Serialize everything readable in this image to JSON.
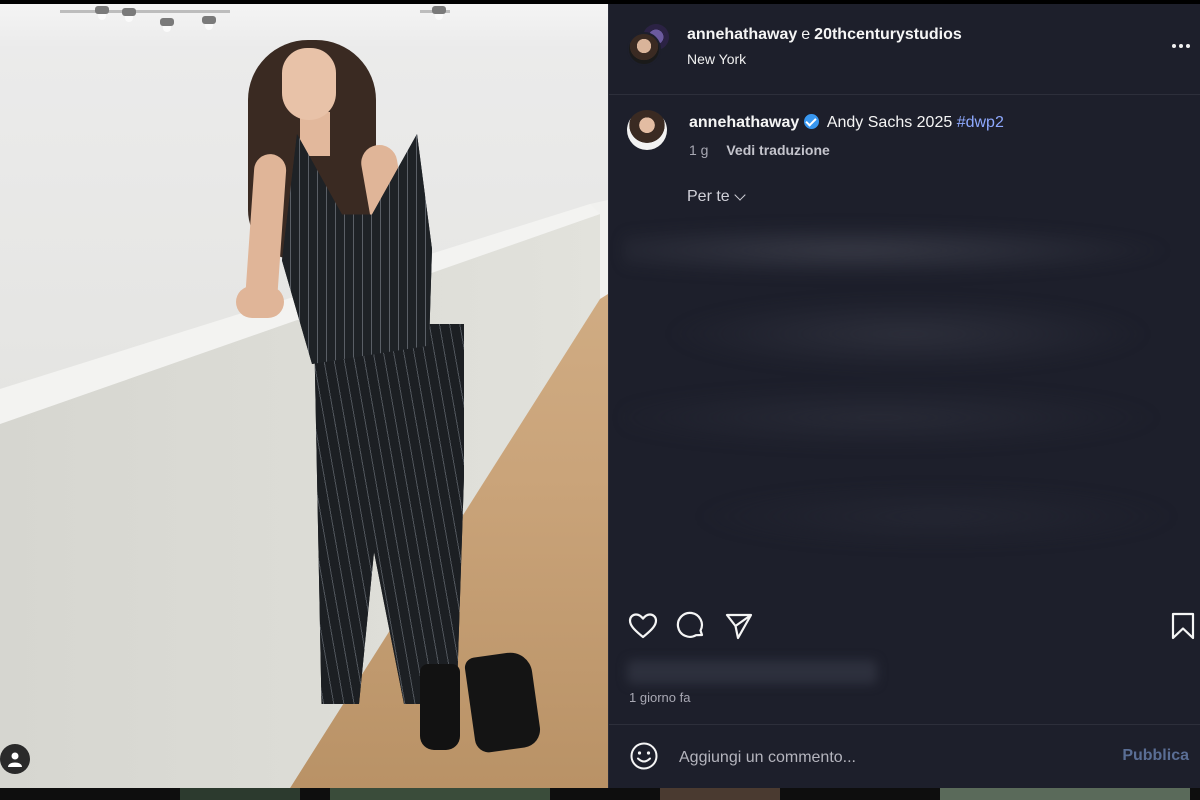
{
  "post": {
    "author": "annehathaway",
    "conjunction": "e",
    "coauthor": "20thcenturystudios",
    "location": "New York"
  },
  "caption": {
    "username": "annehathaway",
    "text": "Andy Sachs 2025",
    "hashtag": "#dwp2",
    "time": "1 g",
    "translate": "Vedi traduzione"
  },
  "comments": {
    "sort_label": "Per te"
  },
  "actions": {
    "like_icon": "heart-icon",
    "comment_icon": "comment-icon",
    "share_icon": "send-icon",
    "save_icon": "bookmark-icon"
  },
  "meta": {
    "time_ago": "1 giorno fa"
  },
  "comment_box": {
    "placeholder": "Aggiungi un commento...",
    "publish_label": "Pubblica"
  },
  "colors": {
    "panel_bg": "#1d1f2b",
    "hashtag": "#8ea9ff",
    "verified": "#3897f0",
    "publish_disabled": "#5a6e95"
  }
}
